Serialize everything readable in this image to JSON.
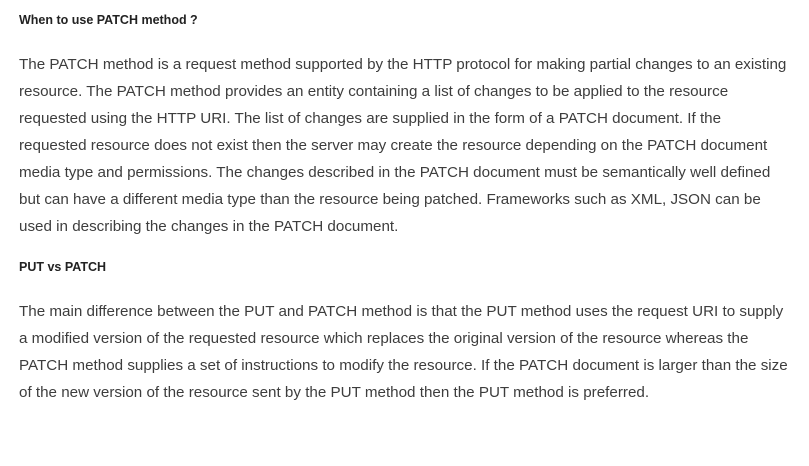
{
  "sections": [
    {
      "heading": "When to use PATCH method ?",
      "paragraph": "The PATCH method is a request method supported by the HTTP protocol for making partial changes to an existing resource. The PATCH method provides an entity containing a list of changes to be applied to the resource requested using the HTTP URI. The list of changes are supplied in the form of a PATCH document. If the requested resource does not exist then the server may create the resource depending on the PATCH document media type and permissions. The changes described in the PATCH document must be semantically well defined but can have a different media type than the resource being patched. Frameworks such as XML, JSON can be used in describing the changes in the PATCH document."
    },
    {
      "heading": "PUT vs PATCH",
      "paragraph": "The main difference between the PUT and PATCH method is that the PUT method uses the request URI to supply a modified version of the requested resource which replaces the original version of the resource whereas the PATCH method supplies a set of instructions to modify the resource. If the PATCH document is larger than the size of the new version of the resource sent by the PUT method then the PUT method is preferred."
    }
  ]
}
